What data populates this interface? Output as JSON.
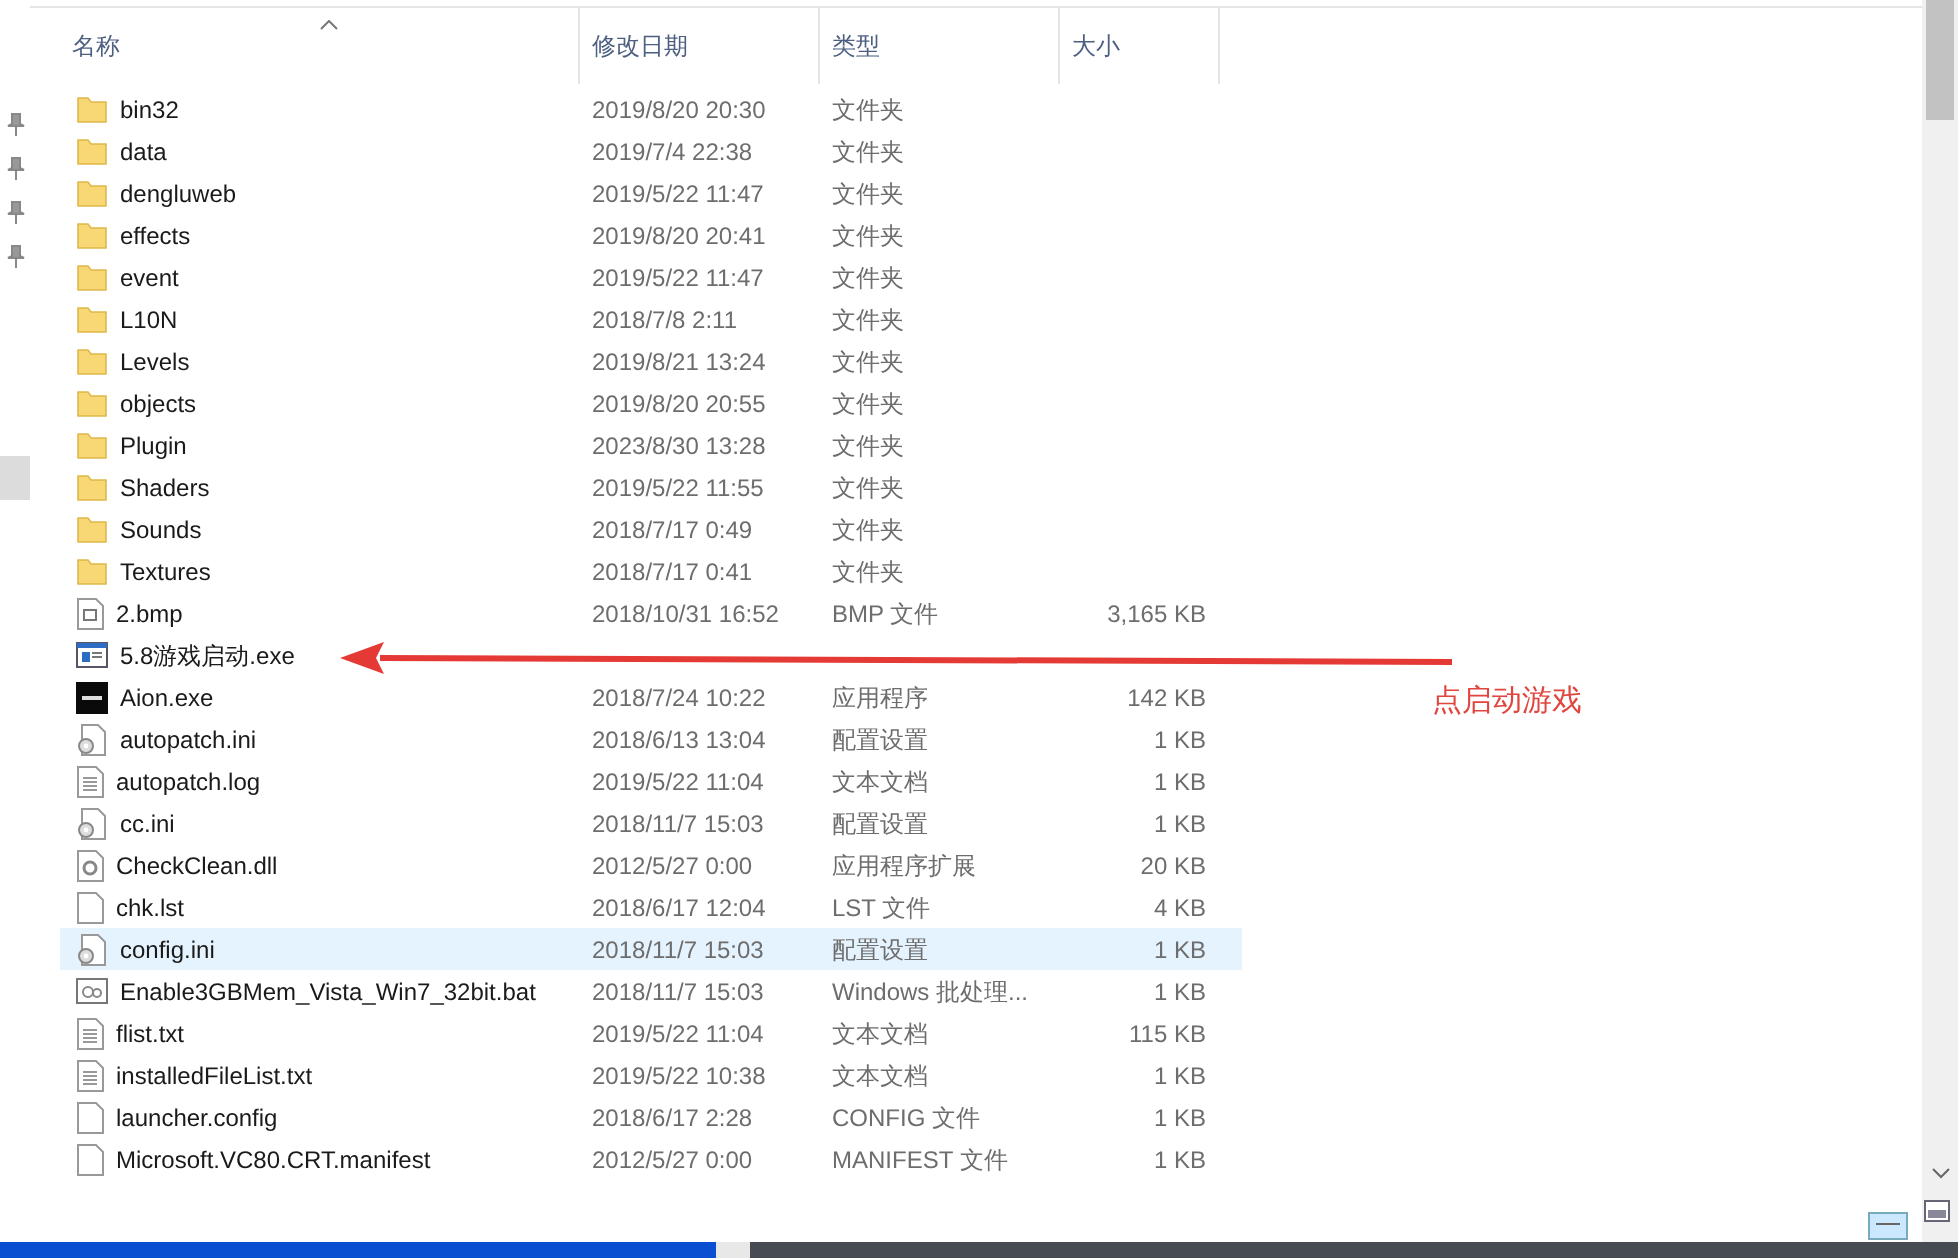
{
  "columns": [
    {
      "label": "名称",
      "sorted": true
    },
    {
      "label": "修改日期",
      "sorted": false
    },
    {
      "label": "类型",
      "sorted": false
    },
    {
      "label": "大小",
      "sorted": false
    }
  ],
  "files": [
    {
      "kind": "folder",
      "name": "bin32",
      "date": "2019/8/20 20:30",
      "type": "文件夹",
      "selected": false
    },
    {
      "kind": "folder",
      "name": "data",
      "date": "2019/7/4 22:38",
      "type": "文件夹",
      "selected": false
    },
    {
      "kind": "folder",
      "name": "dengluweb",
      "date": "2019/5/22 11:47",
      "type": "文件夹",
      "selected": false
    },
    {
      "kind": "folder",
      "name": "effects",
      "date": "2019/8/20 20:41",
      "type": "文件夹",
      "selected": false
    },
    {
      "kind": "folder",
      "name": "event",
      "date": "2019/5/22 11:47",
      "type": "文件夹",
      "selected": false
    },
    {
      "kind": "folder",
      "name": "L10N",
      "date": "2018/7/8 2:11",
      "type": "文件夹",
      "selected": false
    },
    {
      "kind": "folder",
      "name": "Levels",
      "date": "2019/8/21 13:24",
      "type": "文件夹",
      "selected": false
    },
    {
      "kind": "folder",
      "name": "objects",
      "date": "2019/8/20 20:55",
      "type": "文件夹",
      "selected": false
    },
    {
      "kind": "folder",
      "name": "Plugin",
      "date": "2023/8/30 13:28",
      "type": "文件夹",
      "selected": false
    },
    {
      "kind": "folder",
      "name": "Shaders",
      "date": "2019/5/22 11:55",
      "type": "文件夹",
      "selected": false
    },
    {
      "kind": "folder",
      "name": "Sounds",
      "date": "2018/7/17 0:49",
      "type": "文件夹",
      "selected": false
    },
    {
      "kind": "folder",
      "name": "Textures",
      "date": "2018/7/17 0:41",
      "type": "文件夹",
      "selected": false
    },
    {
      "kind": "image",
      "name": "2.bmp",
      "date": "2018/10/31 16:52",
      "type": "BMP 文件",
      "size": "3,165 KB",
      "selected": false
    },
    {
      "kind": "exe",
      "name": "5.8游戏启动.exe",
      "selected": false
    },
    {
      "kind": "app",
      "name": "Aion.exe",
      "date": "2018/7/24 10:22",
      "type": "应用程序",
      "size": "142 KB",
      "selected": false
    },
    {
      "kind": "config",
      "name": "autopatch.ini",
      "date": "2018/6/13 13:04",
      "type": "配置设置",
      "size": "1 KB",
      "selected": false
    },
    {
      "kind": "text",
      "name": "autopatch.log",
      "date": "2019/5/22 11:04",
      "type": "文本文档",
      "size": "1 KB",
      "selected": false
    },
    {
      "kind": "config",
      "name": "cc.ini",
      "date": "2018/11/7 15:03",
      "type": "配置设置",
      "size": "1 KB",
      "selected": false
    },
    {
      "kind": "dll",
      "name": "CheckClean.dll",
      "date": "2012/5/27 0:00",
      "type": "应用程序扩展",
      "size": "20 KB",
      "selected": false
    },
    {
      "kind": "blank",
      "name": "chk.lst",
      "date": "2018/6/17 12:04",
      "type": "LST 文件",
      "size": "4 KB",
      "selected": false
    },
    {
      "kind": "config",
      "name": "config.ini",
      "date": "2018/11/7 15:03",
      "type": "配置设置",
      "size": "1 KB",
      "selected": true
    },
    {
      "kind": "bat",
      "name": "Enable3GBMem_Vista_Win7_32bit.bat",
      "date": "2018/11/7 15:03",
      "type": "Windows 批处理...",
      "size": "1 KB",
      "selected": false
    },
    {
      "kind": "text",
      "name": "flist.txt",
      "date": "2019/5/22 11:04",
      "type": "文本文档",
      "size": "115 KB",
      "selected": false
    },
    {
      "kind": "text",
      "name": "installedFileList.txt",
      "date": "2019/5/22 10:38",
      "type": "文本文档",
      "size": "1 KB",
      "selected": false
    },
    {
      "kind": "blank",
      "name": "launcher.config",
      "date": "2018/6/17 2:28",
      "type": "CONFIG 文件",
      "size": "1 KB",
      "selected": false
    },
    {
      "kind": "blank",
      "name": "Microsoft.VC80.CRT.manifest",
      "date": "2012/5/27 0:00",
      "type": "MANIFEST 文件",
      "size": "1 KB",
      "selected": false
    }
  ],
  "annotation": {
    "text": "点启动游戏"
  }
}
